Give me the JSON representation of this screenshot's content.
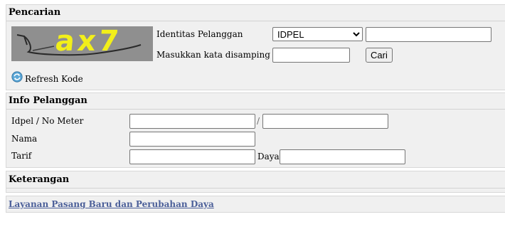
{
  "search": {
    "title": "Pencarian",
    "captcha_text": "ax7",
    "customer_id_label": "Identitas Pelanggan",
    "id_type_selected": "IDPEL",
    "id_value": "",
    "captcha_prompt": "Masukkan kata disamping",
    "captcha_input": "",
    "search_button": "Cari",
    "refresh_label": "Refresh Kode"
  },
  "info": {
    "title": "Info Pelanggan",
    "idpel_label": "Idpel / No Meter",
    "idpel_value": "",
    "separator": "/",
    "meter_value": "",
    "name_label": "Nama",
    "name_value": "",
    "tariff_label": "Tarif",
    "tariff_value": "",
    "power_label": "Daya",
    "power_value": ""
  },
  "notes": {
    "title": "Keterangan"
  },
  "footer": {
    "link_label": "Layanan Pasang Baru dan Perubahan Daya"
  },
  "colors": {
    "panel_bg": "#f0f0f0",
    "border": "#d8d8d8",
    "link": "#4b5f99",
    "captcha_text": "#f2ef1a"
  }
}
